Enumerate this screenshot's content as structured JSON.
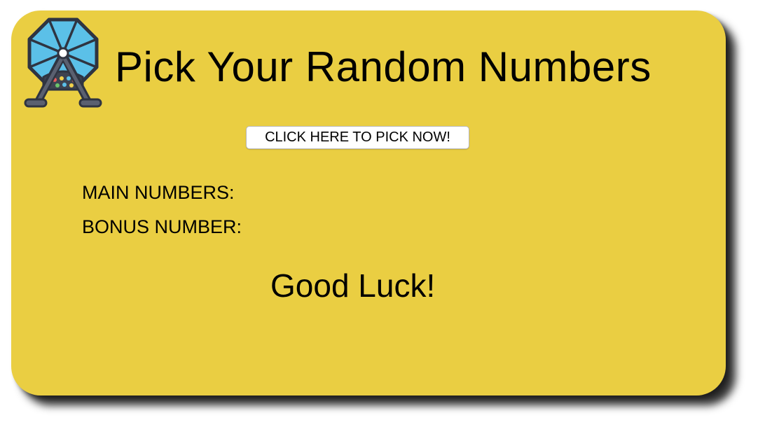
{
  "page": {
    "title": "Pick Your Random Numbers",
    "logo_icon": "lottery-wheel-icon"
  },
  "actions": {
    "pick_button_label": "CLICK HERE TO PICK NOW!"
  },
  "results": {
    "main_numbers_label": "MAIN NUMBERS:",
    "main_numbers_value": "",
    "bonus_number_label": "BONUS NUMBER:",
    "bonus_number_value": ""
  },
  "footer": {
    "message": "Good Luck!"
  },
  "colors": {
    "card_background": "#EACE42",
    "wheel_blue": "#5BC0E8",
    "wheel_frame": "#3E4350",
    "text": "#000000"
  }
}
